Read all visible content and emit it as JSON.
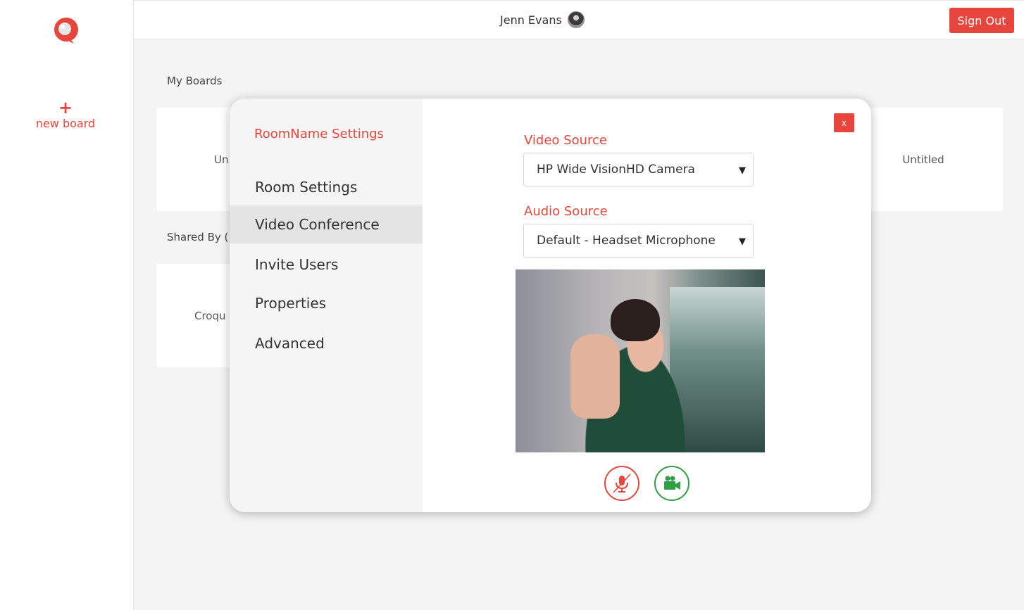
{
  "sidebar": {
    "new_board_plus": "+",
    "new_board_label": "new board"
  },
  "header": {
    "user_name": "Jenn Evans",
    "sign_out_label": "Sign Out"
  },
  "boards": {
    "my_boards_title": "My Boards",
    "my_boards": [
      {
        "title": "Un"
      },
      {
        "title": "Untitled"
      }
    ],
    "shared_title": "Shared By (",
    "shared": [
      {
        "title": "Croqu"
      }
    ]
  },
  "modal": {
    "title": "RoomName Settings",
    "nav_items": [
      {
        "label": "Room Settings"
      },
      {
        "label": "Video Conference"
      },
      {
        "label": "Invite Users"
      },
      {
        "label": "Properties"
      },
      {
        "label": "Advanced"
      }
    ],
    "active_item": "Video Conference",
    "close_label": "x",
    "video_source": {
      "label": "Video Source",
      "value": "HP Wide VisionHD Camera"
    },
    "audio_source": {
      "label": "Audio Source",
      "value": "Default - Headset Microphone"
    },
    "controls": {
      "mic_icon": "microphone-muted-icon",
      "cam_icon": "video-camera-icon"
    }
  },
  "colors": {
    "accent": "#e8453c",
    "camera_on": "#2f9e44"
  }
}
